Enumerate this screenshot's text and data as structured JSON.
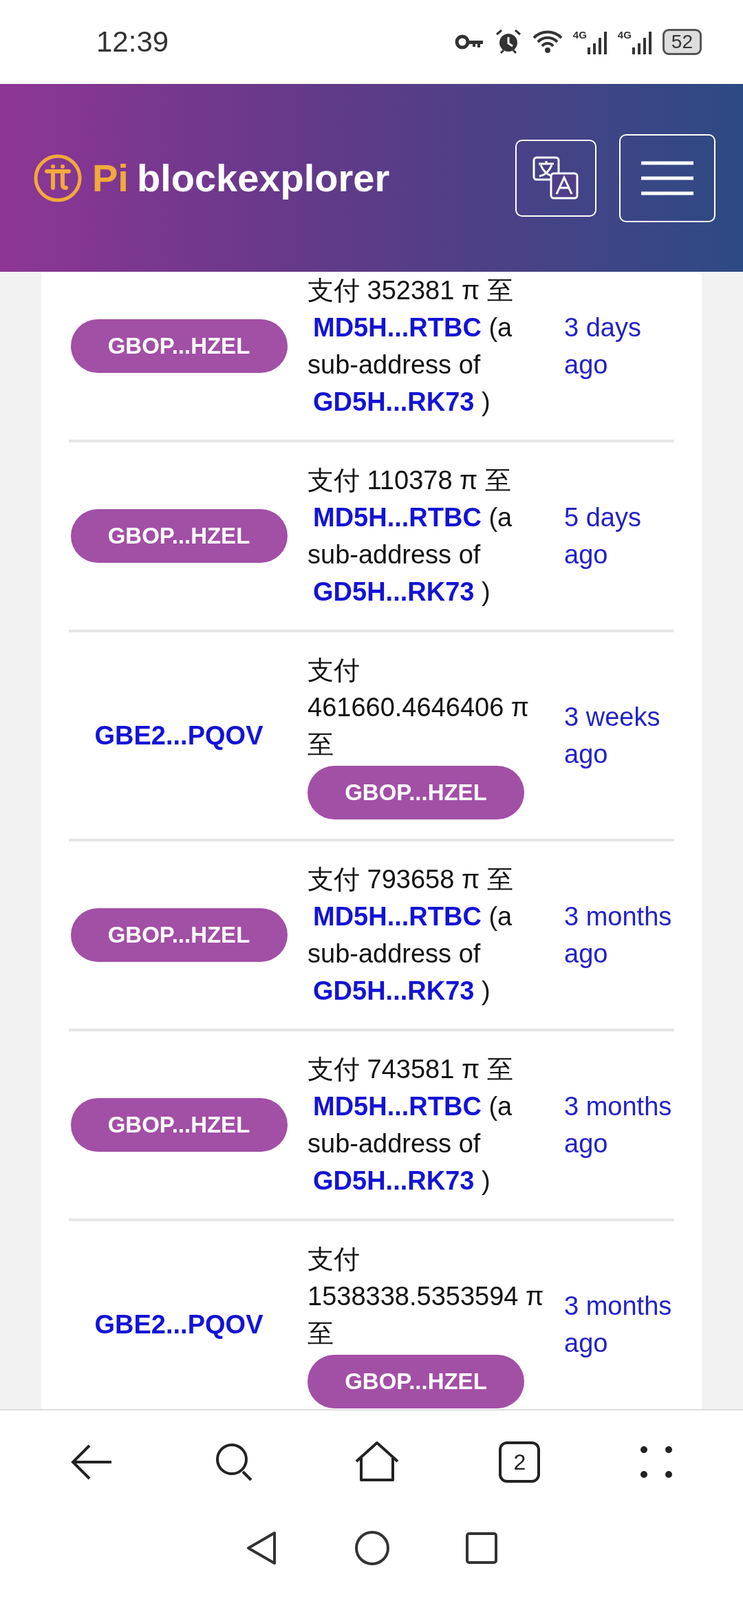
{
  "status_bar": {
    "time": "12:39",
    "networks": [
      "4G",
      "4G"
    ],
    "battery": "52"
  },
  "header": {
    "logo_prefix": "Pi",
    "logo_text": "blockexplorer"
  },
  "transactions": [
    {
      "from": {
        "kind": "badge",
        "address": "GBOP...HZEL"
      },
      "payment": "支付 352381 π 至",
      "to": {
        "kind": "sub-address",
        "address": "MD5H...RTBC",
        "note": "(a sub-address of",
        "parent": "GD5H...RK73",
        "close": ")"
      },
      "time": "3 days ago"
    },
    {
      "from": {
        "kind": "badge",
        "address": "GBOP...HZEL"
      },
      "payment": "支付 110378 π 至",
      "to": {
        "kind": "sub-address",
        "address": "MD5H...RTBC",
        "note": "(a sub-address of",
        "parent": "GD5H...RK73",
        "close": ")"
      },
      "time": "5 days ago"
    },
    {
      "from": {
        "kind": "link",
        "address": "GBE2...PQOV"
      },
      "payment": "支付 461660.4646406 π 至",
      "to": {
        "kind": "badge",
        "address": "GBOP...HZEL"
      },
      "time": "3 weeks ago"
    },
    {
      "from": {
        "kind": "badge",
        "address": "GBOP...HZEL"
      },
      "payment": "支付 793658 π 至",
      "to": {
        "kind": "sub-address",
        "address": "MD5H...RTBC",
        "note": "(a sub-address of",
        "parent": "GD5H...RK73",
        "close": ")"
      },
      "time": "3 months ago"
    },
    {
      "from": {
        "kind": "badge",
        "address": "GBOP...HZEL"
      },
      "payment": "支付 743581 π 至",
      "to": {
        "kind": "sub-address",
        "address": "MD5H...RTBC",
        "note": "(a sub-address of",
        "parent": "GD5H...RK73",
        "close": ")"
      },
      "time": "3 months ago"
    },
    {
      "from": {
        "kind": "link",
        "address": "GBE2...PQOV"
      },
      "payment": "支付 1538338.5353594 π 至",
      "to": {
        "kind": "badge",
        "address": "GBOP...HZEL"
      },
      "time": "3 months ago"
    }
  ],
  "browser_bar": {
    "tab_count": "2"
  }
}
